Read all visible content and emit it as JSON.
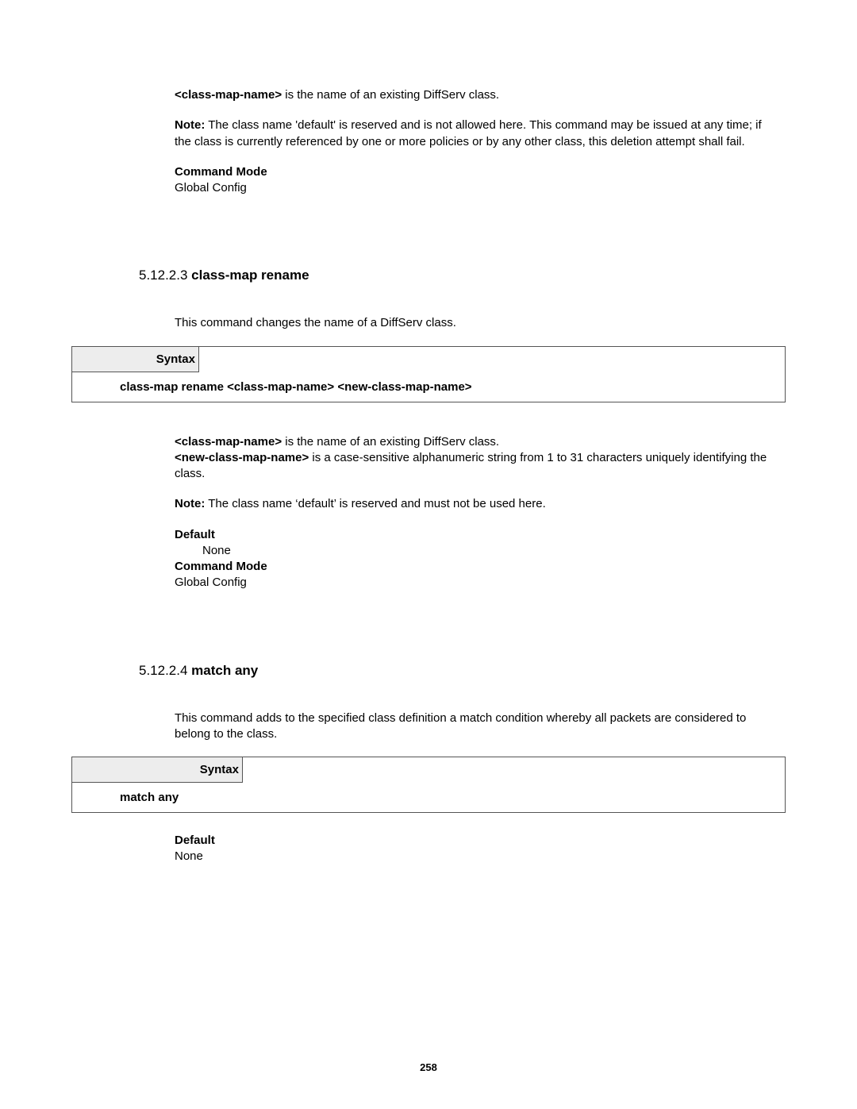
{
  "top": {
    "param": "<class-map-name>",
    "param_desc": " is the name of an existing DiffServ class.",
    "note_label": "Note:",
    "note_text": " The class name 'default' is reserved and is not allowed here. This command may be issued at any time; if the class is currently referenced by one or more policies or by any other class, this deletion attempt shall fail.",
    "cmd_mode_label": "Command Mode",
    "cmd_mode_value": "Global Config"
  },
  "sec1": {
    "number": "5.12.2.3 ",
    "title": "class-map rename",
    "intro": "This command changes the name of a DiffServ class.",
    "syntax_label": "Syntax",
    "syntax_cmd": "class-map rename <class-map-name> <new-class-map-name>",
    "param1": "<class-map-name>",
    "param1_desc": " is the name of an existing DiffServ class.",
    "param2": "<new-class-map-name>",
    "param2_desc": "   is a case-sensitive alphanumeric string from 1 to 31 characters uniquely identifying the class.",
    "note_label": "Note:",
    "note_text": " The class name ‘default’ is reserved and must not be used here.",
    "default_label": "Default",
    "default_value": "None",
    "cmd_mode_label": "Command Mode",
    "cmd_mode_value": "Global Config"
  },
  "sec2": {
    "number": "5.12.2.4 ",
    "title": "match any",
    "intro": "This command adds to the specified class definition a match condition whereby all packets are considered to belong to the class.",
    "syntax_label": "Syntax",
    "syntax_cmd": "match any",
    "default_label": "Default",
    "default_value": "None"
  },
  "page_number": "258"
}
